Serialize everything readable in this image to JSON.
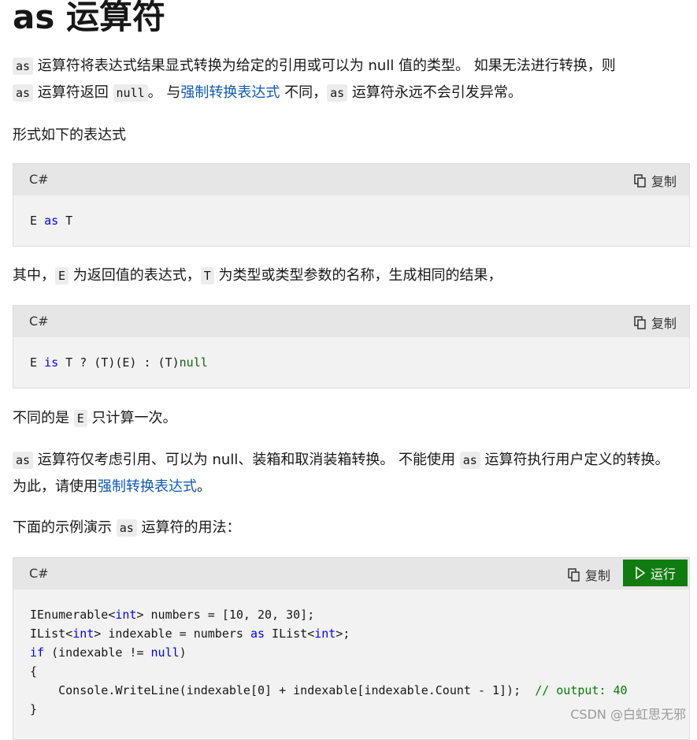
{
  "title": "as 运算符",
  "para1": {
    "code_as": "as",
    "text_a": " 运算符将表达式结果显式转换为给定的引用或可以为 null 值的类型。 如果无法进行转换，则 ",
    "code_as2": "as",
    "text_b": " 运算符返回 ",
    "code_null": "null",
    "text_c": "。 与",
    "link": "强制转换表达式",
    "text_d": " 不同，",
    "code_as3": "as",
    "text_e": " 运算符永远不会引发异常。"
  },
  "para2": "形式如下的表达式",
  "code1": {
    "lang": "C#",
    "copy_label": "复制",
    "line_e": "E ",
    "line_as": "as",
    "line_t": " T"
  },
  "para3": {
    "text_a": "其中，",
    "code_e": "E",
    "text_b": " 为返回值的表达式，",
    "code_t": "T",
    "text_c": " 为类型或类型参数的名称，生成相同的结果，"
  },
  "code2": {
    "lang": "C#",
    "copy_label": "复制",
    "part1": "E ",
    "kw_is": "is",
    "part2": " T ? (T)(E) : (T)",
    "kw_null": "null"
  },
  "para4": {
    "text_a": "不同的是 ",
    "code_e": "E",
    "text_b": " 只计算一次。"
  },
  "para5": {
    "code_as": "as",
    "text_a": " 运算符仅考虑引用、可以为 null、装箱和取消装箱转换。 不能使用 ",
    "code_as2": "as",
    "text_b": " 运算符执行用户定义的转换。 为此，请使用",
    "link": "强制转换表达式",
    "text_c": "。"
  },
  "para6": {
    "text_a": "下面的示例演示 ",
    "code_as": "as",
    "text_b": " 运算符的用法："
  },
  "code3": {
    "lang": "C#",
    "copy_label": "复制",
    "run_label": "运行",
    "l1a": "IEnumerable<",
    "l1kw": "int",
    "l1b": "> numbers = [10, 20, 30];",
    "l2a": "IList<",
    "l2kw": "int",
    "l2b": "> indexable = numbers ",
    "l2as": "as",
    "l2c": " IList<",
    "l2kw2": "int",
    "l2d": ">;",
    "l3kw": "if",
    "l3a": " (indexable != ",
    "l3null": "null",
    "l3b": ")",
    "l4": "{",
    "l5a": "    Console.WriteLine(indexable[0] + indexable[indexable.Count - 1]);  ",
    "l5cm": "// output: 40",
    "l6": "}"
  },
  "watermark": "CSDN @白虹思无邪",
  "colors": {
    "link": "#0f5ab4",
    "keyword": "#0101fd",
    "comment": "#008000",
    "run_button": "#107c10"
  },
  "icons": [
    "copy-icon",
    "play-icon"
  ]
}
